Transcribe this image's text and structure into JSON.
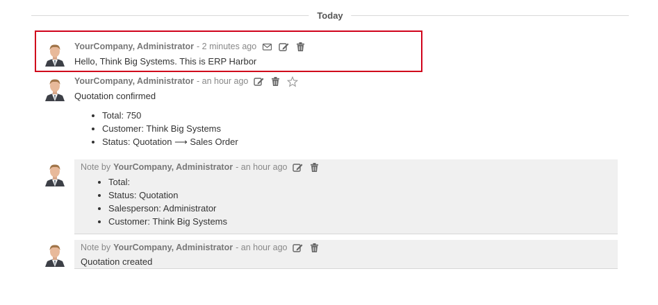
{
  "day_separator": "Today",
  "messages": [
    {
      "author": "YourCompany, Administrator",
      "time": "- 2 minutes ago",
      "body": "Hello, Think Big Systems. This is ERP Harbor"
    },
    {
      "author": "YourCompany, Administrator",
      "time": "- an hour ago",
      "body": "Quotation confirmed",
      "values": [
        {
          "field": "Total:",
          "value": "750"
        },
        {
          "field": "Customer:",
          "value": "Think Big Systems"
        },
        {
          "field": "Status:",
          "old": "Quotation",
          "arrow": "⟶",
          "new": "Sales Order"
        }
      ]
    },
    {
      "prefix": "Note by",
      "author": "YourCompany, Administrator",
      "time": "- an hour ago",
      "values": [
        {
          "field": "Total:",
          "value": ""
        },
        {
          "field": "Status:",
          "value": "Quotation"
        },
        {
          "field": "Salesperson:",
          "value": "Administrator"
        },
        {
          "field": "Customer:",
          "value": "Think Big Systems"
        }
      ]
    },
    {
      "prefix": "Note by",
      "author": "YourCompany, Administrator",
      "time": "- an hour ago",
      "body": "Quotation created"
    }
  ],
  "icons": {
    "mail": "envelope-icon",
    "edit": "edit-icon",
    "delete": "trash-icon",
    "star": "star-icon",
    "avatar": "avatar"
  },
  "colors": {
    "highlight": "#d0021b",
    "note_bg": "#f0f0f0"
  }
}
